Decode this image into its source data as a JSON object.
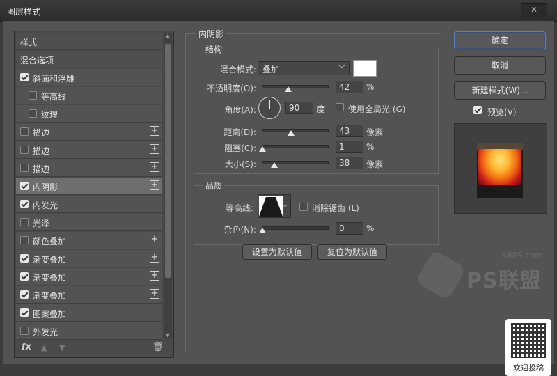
{
  "window": {
    "title": "图层样式",
    "close_label": "✕"
  },
  "styles_list": {
    "items": [
      {
        "label": "样式",
        "checkbox": false,
        "checked": false,
        "plus": false,
        "indent": false,
        "header": true
      },
      {
        "label": "混合选项",
        "checkbox": false,
        "checked": false,
        "plus": false,
        "indent": false,
        "header": true
      },
      {
        "label": "斜面和浮雕",
        "checkbox": true,
        "checked": true,
        "plus": false,
        "indent": false
      },
      {
        "label": "等高线",
        "checkbox": true,
        "checked": false,
        "plus": false,
        "indent": true
      },
      {
        "label": "纹理",
        "checkbox": true,
        "checked": false,
        "plus": false,
        "indent": true
      },
      {
        "label": "描边",
        "checkbox": true,
        "checked": false,
        "plus": true,
        "indent": false
      },
      {
        "label": "描边",
        "checkbox": true,
        "checked": false,
        "plus": true,
        "indent": false
      },
      {
        "label": "描边",
        "checkbox": true,
        "checked": false,
        "plus": true,
        "indent": false
      },
      {
        "label": "内阴影",
        "checkbox": true,
        "checked": true,
        "plus": true,
        "indent": false,
        "selected": true
      },
      {
        "label": "内发光",
        "checkbox": true,
        "checked": true,
        "plus": false,
        "indent": false
      },
      {
        "label": "光泽",
        "checkbox": true,
        "checked": false,
        "plus": false,
        "indent": false
      },
      {
        "label": "颜色叠加",
        "checkbox": true,
        "checked": false,
        "plus": true,
        "indent": false
      },
      {
        "label": "渐变叠加",
        "checkbox": true,
        "checked": true,
        "plus": true,
        "indent": false
      },
      {
        "label": "渐变叠加",
        "checkbox": true,
        "checked": true,
        "plus": true,
        "indent": false
      },
      {
        "label": "渐变叠加",
        "checkbox": true,
        "checked": true,
        "plus": true,
        "indent": false
      },
      {
        "label": "图案叠加",
        "checkbox": true,
        "checked": true,
        "plus": false,
        "indent": false
      },
      {
        "label": "外发光",
        "checkbox": true,
        "checked": false,
        "plus": false,
        "indent": false
      }
    ],
    "fx_label": "fx",
    "plus_glyph": "+"
  },
  "inner_shadow": {
    "section_title": "内阴影",
    "structure_title": "结构",
    "blend_mode_label": "混合模式:",
    "blend_mode_value": "叠加",
    "color_swatch": "#ffffff",
    "opacity_label": "不透明度(O):",
    "opacity_value": "42",
    "opacity_unit": "%",
    "angle_label": "角度(A):",
    "angle_value": "90",
    "angle_unit": "度",
    "global_light_label": "使用全局光 (G)",
    "global_light_checked": false,
    "distance_label": "距离(D):",
    "distance_value": "43",
    "distance_unit": "像素",
    "choke_label": "阻塞(C):",
    "choke_value": "1",
    "choke_unit": "%",
    "size_label": "大小(S):",
    "size_value": "38",
    "size_unit": "像素",
    "quality_title": "品质",
    "contour_label": "等高线:",
    "antialias_label": "消除锯齿 (L)",
    "antialias_checked": false,
    "noise_label": "杂色(N):",
    "noise_value": "0",
    "noise_unit": "%",
    "set_default_label": "设置为默认值",
    "reset_default_label": "复位为默认值"
  },
  "right_panel": {
    "ok_label": "确定",
    "cancel_label": "取消",
    "new_style_label": "新建样式(W)...",
    "preview_label": "预览(V)",
    "preview_checked": true
  },
  "watermark": {
    "site": "68PS.com",
    "logo": "PS联盟"
  },
  "qr": {
    "caption": "欢迎投稿"
  }
}
